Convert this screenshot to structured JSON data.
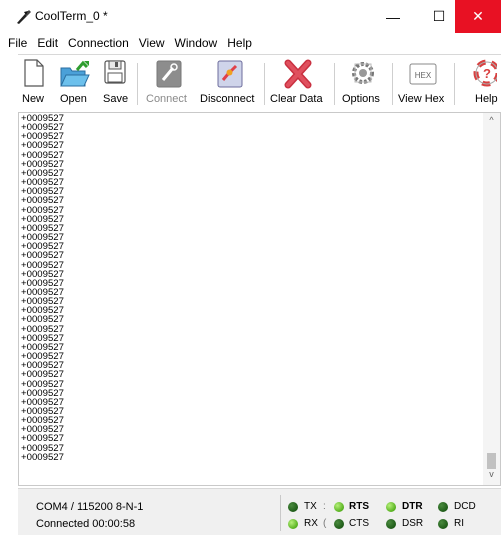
{
  "window": {
    "title": "CoolTerm_0 *",
    "minimize_glyph": "—",
    "maximize_glyph": "☐",
    "close_glyph": "✕",
    "close_color": "#e81123"
  },
  "menu": [
    "File",
    "Edit",
    "Connection",
    "View",
    "Window",
    "Help"
  ],
  "toolbar": {
    "new": {
      "label": "New",
      "icon": "new-file-icon"
    },
    "open": {
      "label": "Open",
      "icon": "open-folder-icon"
    },
    "save": {
      "label": "Save",
      "icon": "floppy-disk-icon"
    },
    "connect": {
      "label": "Connect",
      "icon": "connect-plug-icon",
      "enabled": false
    },
    "disconnect": {
      "label": "Disconnect",
      "icon": "disconnect-plug-icon"
    },
    "clear_data": {
      "label": "Clear Data",
      "icon": "red-x-icon"
    },
    "options": {
      "label": "Options",
      "icon": "gears-icon"
    },
    "view_hex": {
      "label": "View Hex",
      "icon": "hex-icon",
      "icon_text": "HEX"
    },
    "help": {
      "label": "Help",
      "icon": "lifebuoy-icon"
    }
  },
  "terminal": {
    "lines": [
      "+0009527",
      "+0009527",
      "+0009527",
      "+0009527",
      "+0009527",
      "+0009527",
      "+0009527",
      "+0009527",
      "+0009527",
      "+0009527",
      "+0009527",
      "+0009527",
      "+0009527",
      "+0009527",
      "+0009527",
      "+0009527",
      "+0009527",
      "+0009527",
      "+0009527",
      "+0009527",
      "+0009527",
      "+0009527",
      "+0009527",
      "+0009527",
      "+0009527",
      "+0009527",
      "+0009527",
      "+0009527",
      "+0009527",
      "+0009527",
      "+0009527",
      "+0009527",
      "+0009527",
      "+0009527",
      "+0009527",
      "+0009527",
      "+0009527",
      "+0009527"
    ],
    "scroll_up_glyph": "^",
    "scroll_down_glyph": "v"
  },
  "status": {
    "port": "COM4 / 115200 8-N-1",
    "connection": "Connected 00:00:58",
    "leds": {
      "tx": {
        "label": "TX",
        "state": "off"
      },
      "rx": {
        "label": "RX",
        "state": "on"
      },
      "rts": {
        "label": "RTS",
        "state": "on"
      },
      "cts": {
        "label": "CTS",
        "state": "off"
      },
      "dtr": {
        "label": "DTR",
        "state": "on"
      },
      "dsr": {
        "label": "DSR",
        "state": "off"
      },
      "dcd": {
        "label": "DCD",
        "state": "off"
      },
      "ri": {
        "label": "RI",
        "state": "off"
      }
    },
    "tick1": ":",
    "tick2": "("
  }
}
